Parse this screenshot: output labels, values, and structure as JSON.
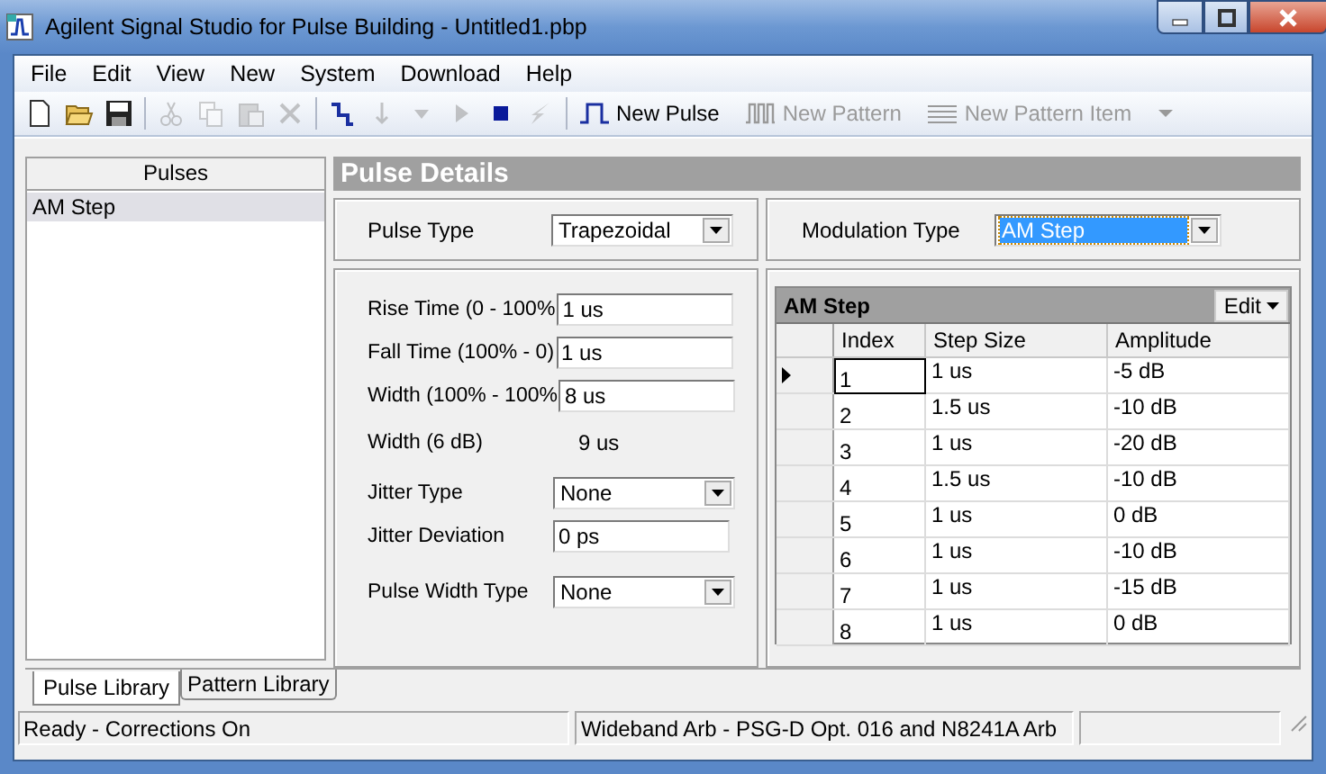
{
  "window": {
    "title": "Agilent Signal Studio for Pulse Building - Untitled1.pbp"
  },
  "menu": [
    "File",
    "Edit",
    "View",
    "New",
    "System",
    "Download",
    "Help"
  ],
  "toolbar": {
    "icon_buttons": [
      {
        "disabled": false
      },
      {
        "disabled": false
      },
      {
        "disabled": false
      },
      {
        "disabled": true
      },
      {
        "disabled": true
      },
      {
        "disabled": true
      },
      {
        "disabled": true
      },
      {
        "disabled": false
      },
      {
        "disabled": true
      },
      {
        "disabled": true
      },
      {
        "disabled": true
      },
      {
        "disabled": false
      },
      {
        "disabled": true
      }
    ],
    "text_buttons": [
      {
        "label": "New Pulse",
        "disabled": false
      },
      {
        "label": "New Pattern",
        "disabled": true
      },
      {
        "label": "New Pattern Item",
        "disabled": true
      }
    ]
  },
  "pulses": {
    "header": "Pulses",
    "items": [
      {
        "label": "AM Step",
        "selected": true
      }
    ]
  },
  "details": {
    "title": "Pulse Details",
    "pulse_type": {
      "label": "Pulse Type",
      "value": "Trapezoidal"
    },
    "modulation_type": {
      "label": "Modulation Type",
      "value": "AM Step",
      "focused": true
    },
    "fields": [
      {
        "kind": "input",
        "label": "Rise Time (0 - 100%",
        "value": "1 us"
      },
      {
        "kind": "input",
        "label": "Fall Time (100% - 0)",
        "value": "1 us"
      },
      {
        "kind": "input",
        "label": "Width (100% - 100%",
        "value": "8 us"
      },
      {
        "kind": "readout",
        "label": "Width (6 dB)",
        "value": "9 us"
      },
      {
        "kind": "select",
        "label": "Jitter Type",
        "value": "None"
      },
      {
        "kind": "input",
        "label": "Jitter Deviation",
        "value": "0 ps"
      },
      {
        "kind": "select",
        "label": "Pulse Width Type",
        "value": "None"
      }
    ]
  },
  "step_table": {
    "title": "AM Step",
    "edit_button": "Edit",
    "columns": [
      "Index",
      "Step Size",
      "Amplitude"
    ],
    "rows": [
      {
        "cells": [
          "1",
          "1 us",
          "-5 dB"
        ],
        "selected": true
      },
      {
        "cells": [
          "2",
          "1.5 us",
          "-10 dB"
        ],
        "selected": false
      },
      {
        "cells": [
          "3",
          "1 us",
          "-20 dB"
        ],
        "selected": false
      },
      {
        "cells": [
          "4",
          "1.5 us",
          "-10 dB"
        ],
        "selected": false
      },
      {
        "cells": [
          "5",
          "1 us",
          "0 dB"
        ],
        "selected": false
      },
      {
        "cells": [
          "6",
          "1 us",
          "-10 dB"
        ],
        "selected": false
      },
      {
        "cells": [
          "7",
          "1 us",
          "-15 dB"
        ],
        "selected": false
      },
      {
        "cells": [
          "8",
          "1 us",
          "0 dB"
        ],
        "selected": false
      }
    ]
  },
  "tabs": [
    {
      "label": "Pulse Library",
      "selected": true
    },
    {
      "label": "Pattern Library",
      "selected": false
    }
  ],
  "status_bar": [
    "Ready - Corrections On",
    "Wideband Arb - PSG-D Opt. 016 and N8241A Arb"
  ]
}
